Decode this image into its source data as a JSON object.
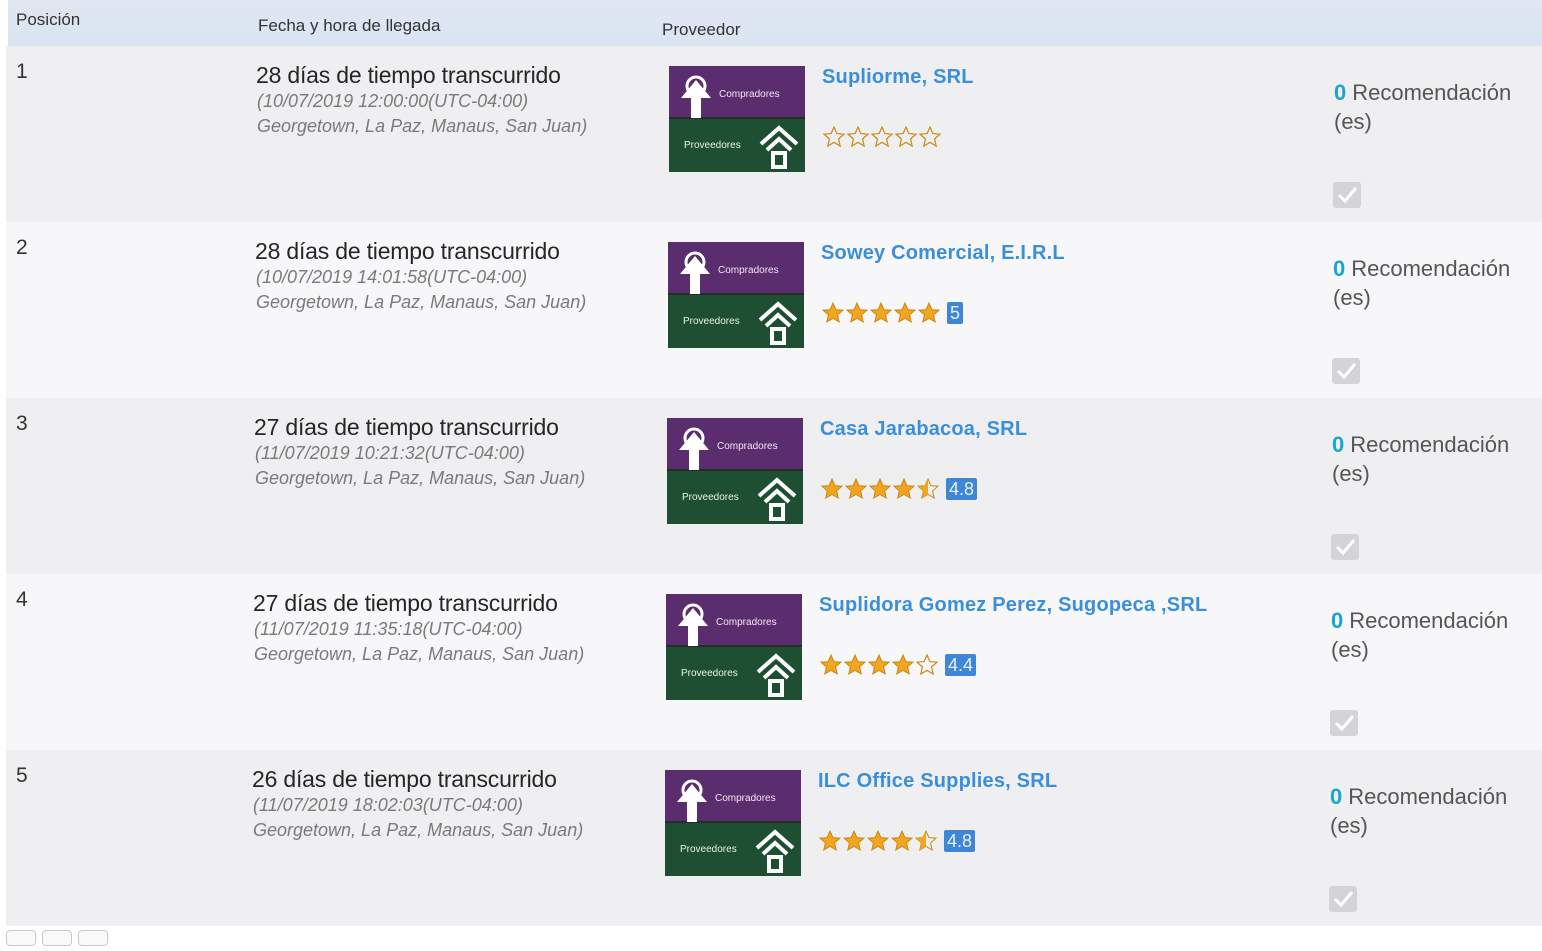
{
  "header": {
    "position": "Posición",
    "arrival": "Fecha y hora de llegada",
    "provider": "Proveedor"
  },
  "colors": {
    "provider_name": "#3b8fd9",
    "rating_badge": "#3f86d6",
    "recommendation_count": "#1aa6c9",
    "logo_purple": "#5a2e6e",
    "logo_green": "#1f4f33",
    "star_filled": "#f1a520"
  },
  "rows": [
    {
      "position": "1",
      "elapsed": "28 días de tiempo transcurrido",
      "datetime": "(10/07/2019 12:00:00(UTC-04:00)",
      "zones": "Georgetown, La Paz, Manaus, San Juan)",
      "provider": "Supliorme, SRL",
      "rating": 0,
      "rating_label": "",
      "rec_count": "0",
      "rec_label": "Recomendación (es)",
      "logo_top": "Compradores",
      "logo_bottom": "Proveedores"
    },
    {
      "position": "2",
      "elapsed": "28 días de tiempo transcurrido",
      "datetime": "(10/07/2019 14:01:58(UTC-04:00)",
      "zones": "Georgetown, La Paz, Manaus, San Juan)",
      "provider": "Sowey Comercial, E.I.R.L",
      "rating": 5,
      "rating_label": "5",
      "rec_count": "0",
      "rec_label": "Recomendación (es)",
      "logo_top": "Compradores",
      "logo_bottom": "Proveedores"
    },
    {
      "position": "3",
      "elapsed": "27 días de tiempo transcurrido",
      "datetime": "(11/07/2019 10:21:32(UTC-04:00)",
      "zones": "Georgetown, La Paz, Manaus, San Juan)",
      "provider": "Casa Jarabacoa, SRL",
      "rating": 4.5,
      "rating_label": "4.8",
      "rec_count": "0",
      "rec_label": "Recomendación (es)",
      "logo_top": "Compradores",
      "logo_bottom": "Proveedores"
    },
    {
      "position": "4",
      "elapsed": "27 días de tiempo transcurrido",
      "datetime": "(11/07/2019 11:35:18(UTC-04:00)",
      "zones": "Georgetown, La Paz, Manaus, San Juan)",
      "provider": "Suplidora Gomez Perez, Sugopeca ,SRL",
      "rating": 4,
      "rating_label": "4.4",
      "rec_count": "0",
      "rec_label": "Recomendación (es)",
      "logo_top": "Compradores",
      "logo_bottom": "Proveedores"
    },
    {
      "position": "5",
      "elapsed": "26 días de tiempo transcurrido",
      "datetime": "(11/07/2019 18:02:03(UTC-04:00)",
      "zones": "Georgetown, La Paz, Manaus, San Juan)",
      "provider": "ILC Office Supplies, SRL",
      "rating": 4.5,
      "rating_label": "4.8",
      "rec_count": "0",
      "rec_label": "Recomendación (es)",
      "logo_top": "Compradores",
      "logo_bottom": "Proveedores"
    }
  ]
}
